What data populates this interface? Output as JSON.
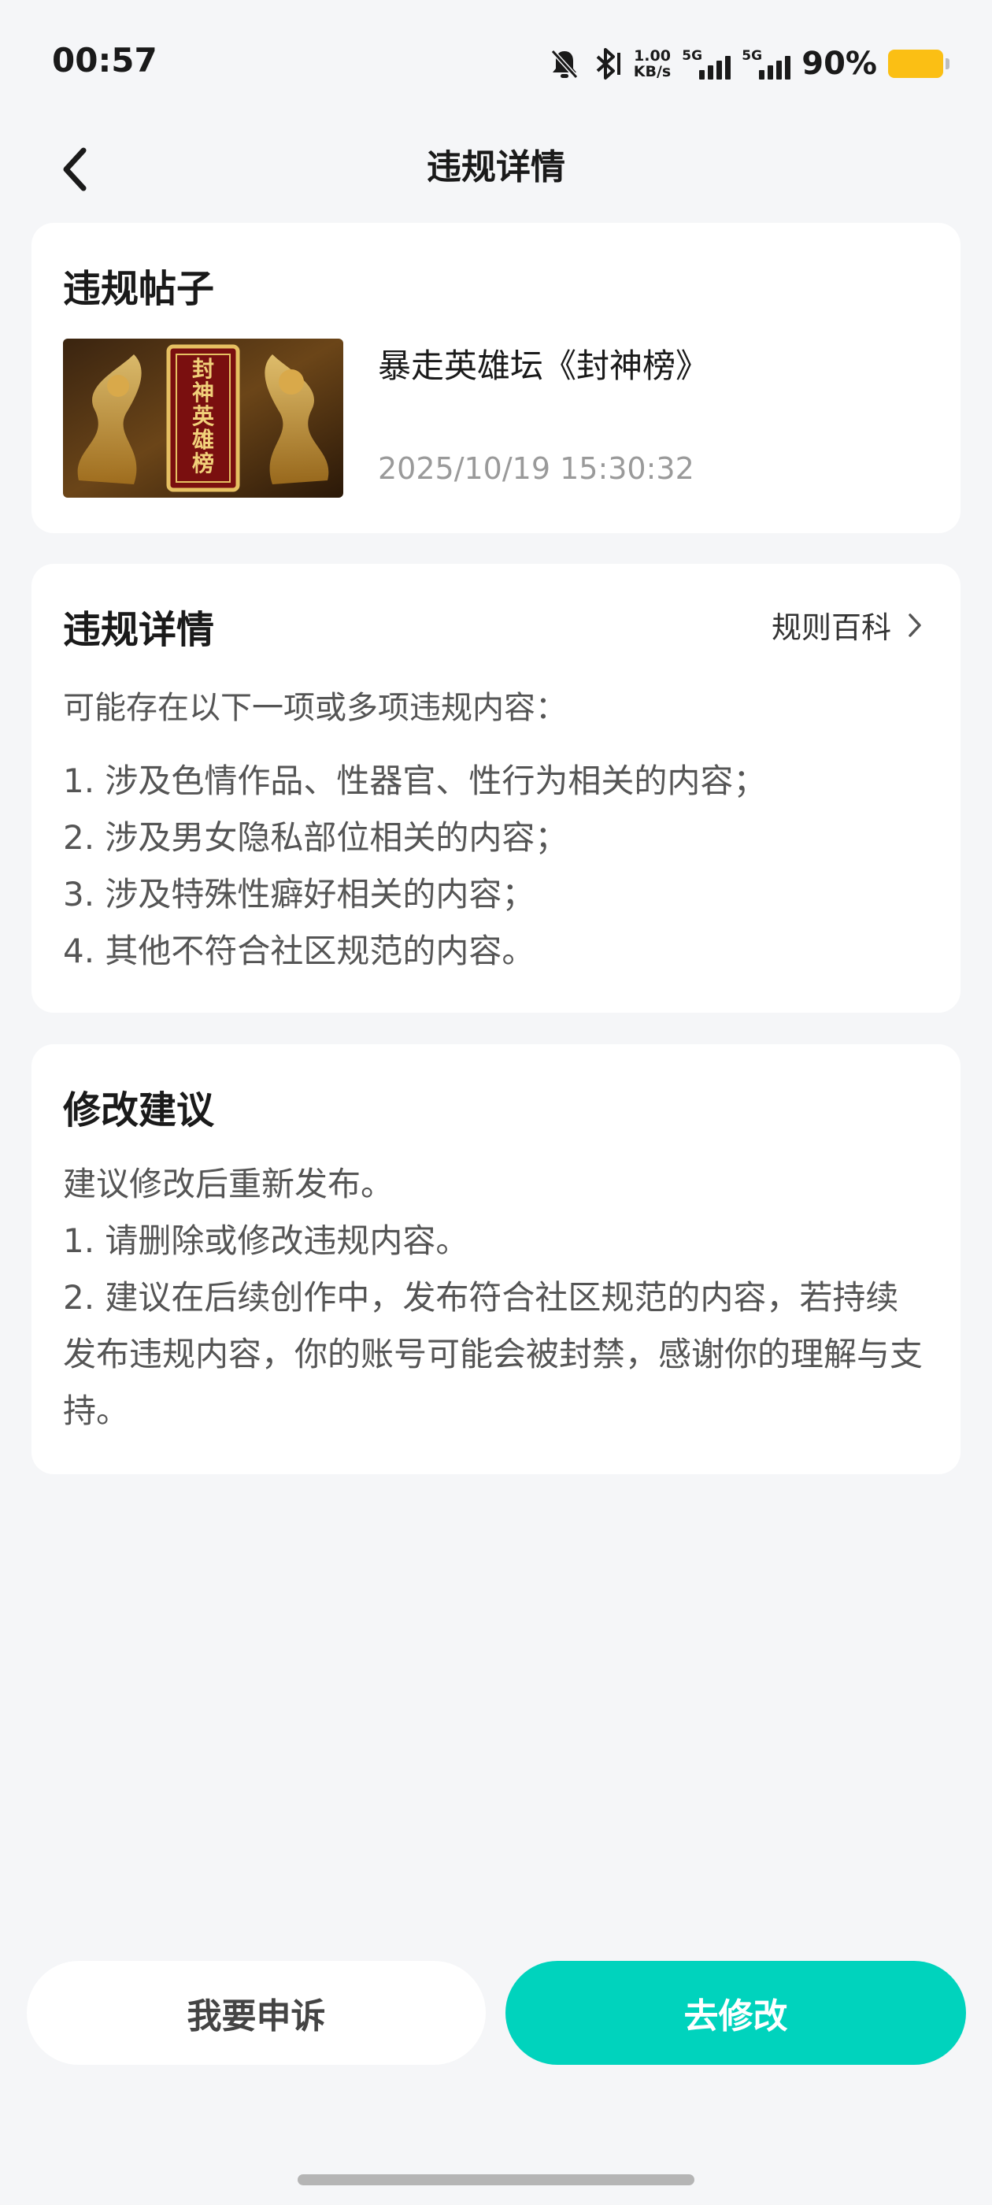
{
  "status_bar": {
    "time": "00:57",
    "speed_value": "1.00",
    "speed_unit": "KB/s",
    "sim1_label": "5G",
    "sim2_label": "5G",
    "battery_percent": "90%",
    "battery_color": "#fbbf14",
    "icons": [
      "bell-mute-icon",
      "bluetooth-icon",
      "signal-icon",
      "battery-icon"
    ]
  },
  "header": {
    "title": "违规详情",
    "back_icon": "chevron-left-icon"
  },
  "post_card": {
    "title": "违规帖子",
    "post_title": "暴走英雄坛《封神榜》",
    "post_time": "2025/10/19 15:30:32",
    "thumbnail_text": "封神英雄榜"
  },
  "detail_card": {
    "title": "违规详情",
    "rule_link": "规则百科",
    "intro": "可能存在以下一项或多项违规内容：",
    "items": [
      "1. 涉及色情作品、性器官、性行为相关的内容；",
      "2. 涉及男女隐私部位相关的内容；",
      "3. 涉及特殊性癖好相关的内容；",
      "4. 其他不符合社区规范的内容。"
    ]
  },
  "suggest_card": {
    "title": "修改建议",
    "lines": [
      "建议修改后重新发布。",
      "1. 请删除或修改违规内容。",
      "2. 建议在后续创作中，发布符合社区规范的内容，若持续发布违规内容，你的账号可能会被封禁，感谢你的理解与支持。"
    ]
  },
  "actions": {
    "appeal_label": "我要申诉",
    "modify_label": "去修改",
    "accent_color": "#00d3bd"
  }
}
